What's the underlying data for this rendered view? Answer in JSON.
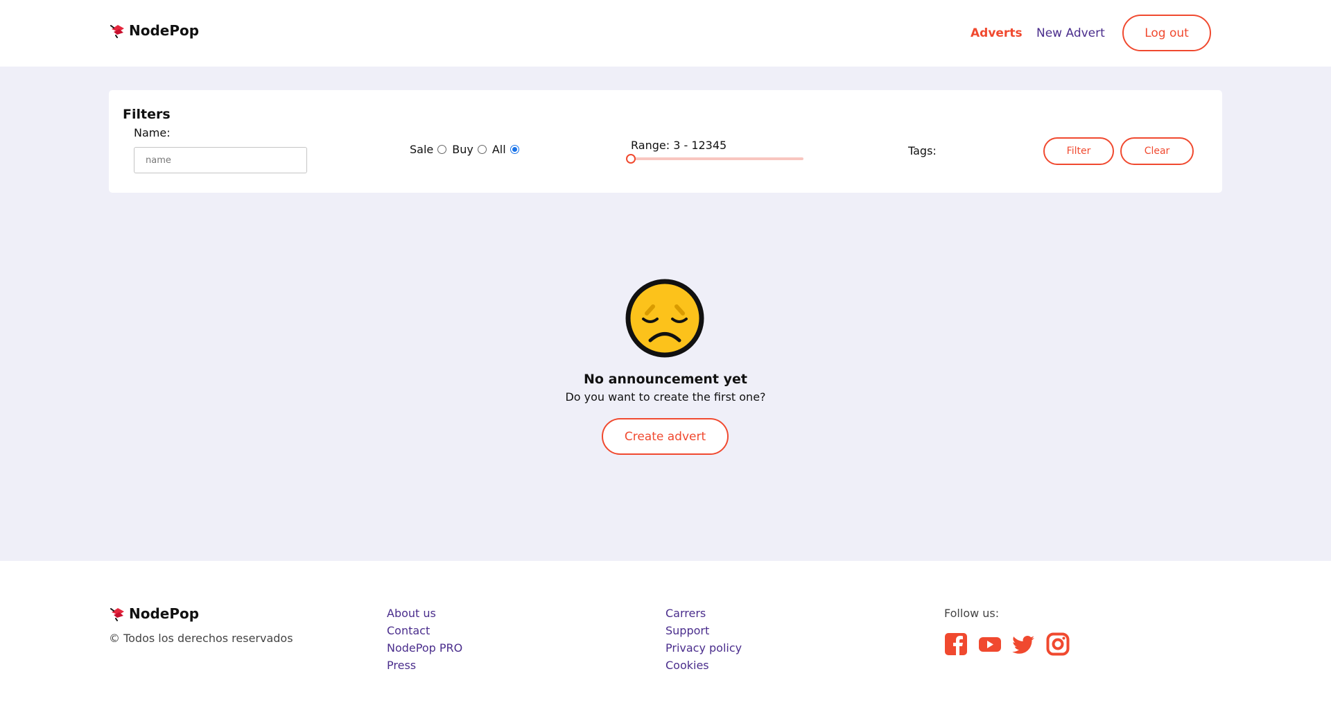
{
  "brand": {
    "name": "NodePop",
    "accent_color": "#f0492f",
    "link_color": "#4a2d8c",
    "background_color": "#efeff8"
  },
  "header": {
    "nav": {
      "adverts_label": "Adverts",
      "new_advert_label": "New Advert"
    },
    "logout_label": "Log out"
  },
  "filters": {
    "title": "Filters",
    "name_label": "Name:",
    "name_value": "",
    "name_placeholder": "name",
    "type_options": [
      {
        "label": "Sale",
        "checked": false
      },
      {
        "label": "Buy",
        "checked": false
      },
      {
        "label": "All",
        "checked": true
      }
    ],
    "range_label": "Range: 3 - 12345",
    "range_min": 3,
    "range_max": 12345,
    "tags_label": "Tags:",
    "filter_button": "Filter",
    "clear_button": "Clear"
  },
  "empty_state": {
    "icon": "sad-face-icon",
    "title": "No announcement yet",
    "subtitle": "Do you want to create the first one?",
    "button": "Create advert"
  },
  "footer": {
    "copyright": "© Todos los derechos reservados",
    "links_col1": [
      "About us",
      "Contact",
      "NodePop PRO",
      "Press"
    ],
    "links_col2": [
      "Carrers",
      "Support",
      "Privacy policy",
      "Cookies"
    ],
    "follow_label": "Follow us:",
    "socials": [
      "facebook-icon",
      "youtube-icon",
      "twitter-icon",
      "instagram-icon"
    ]
  }
}
